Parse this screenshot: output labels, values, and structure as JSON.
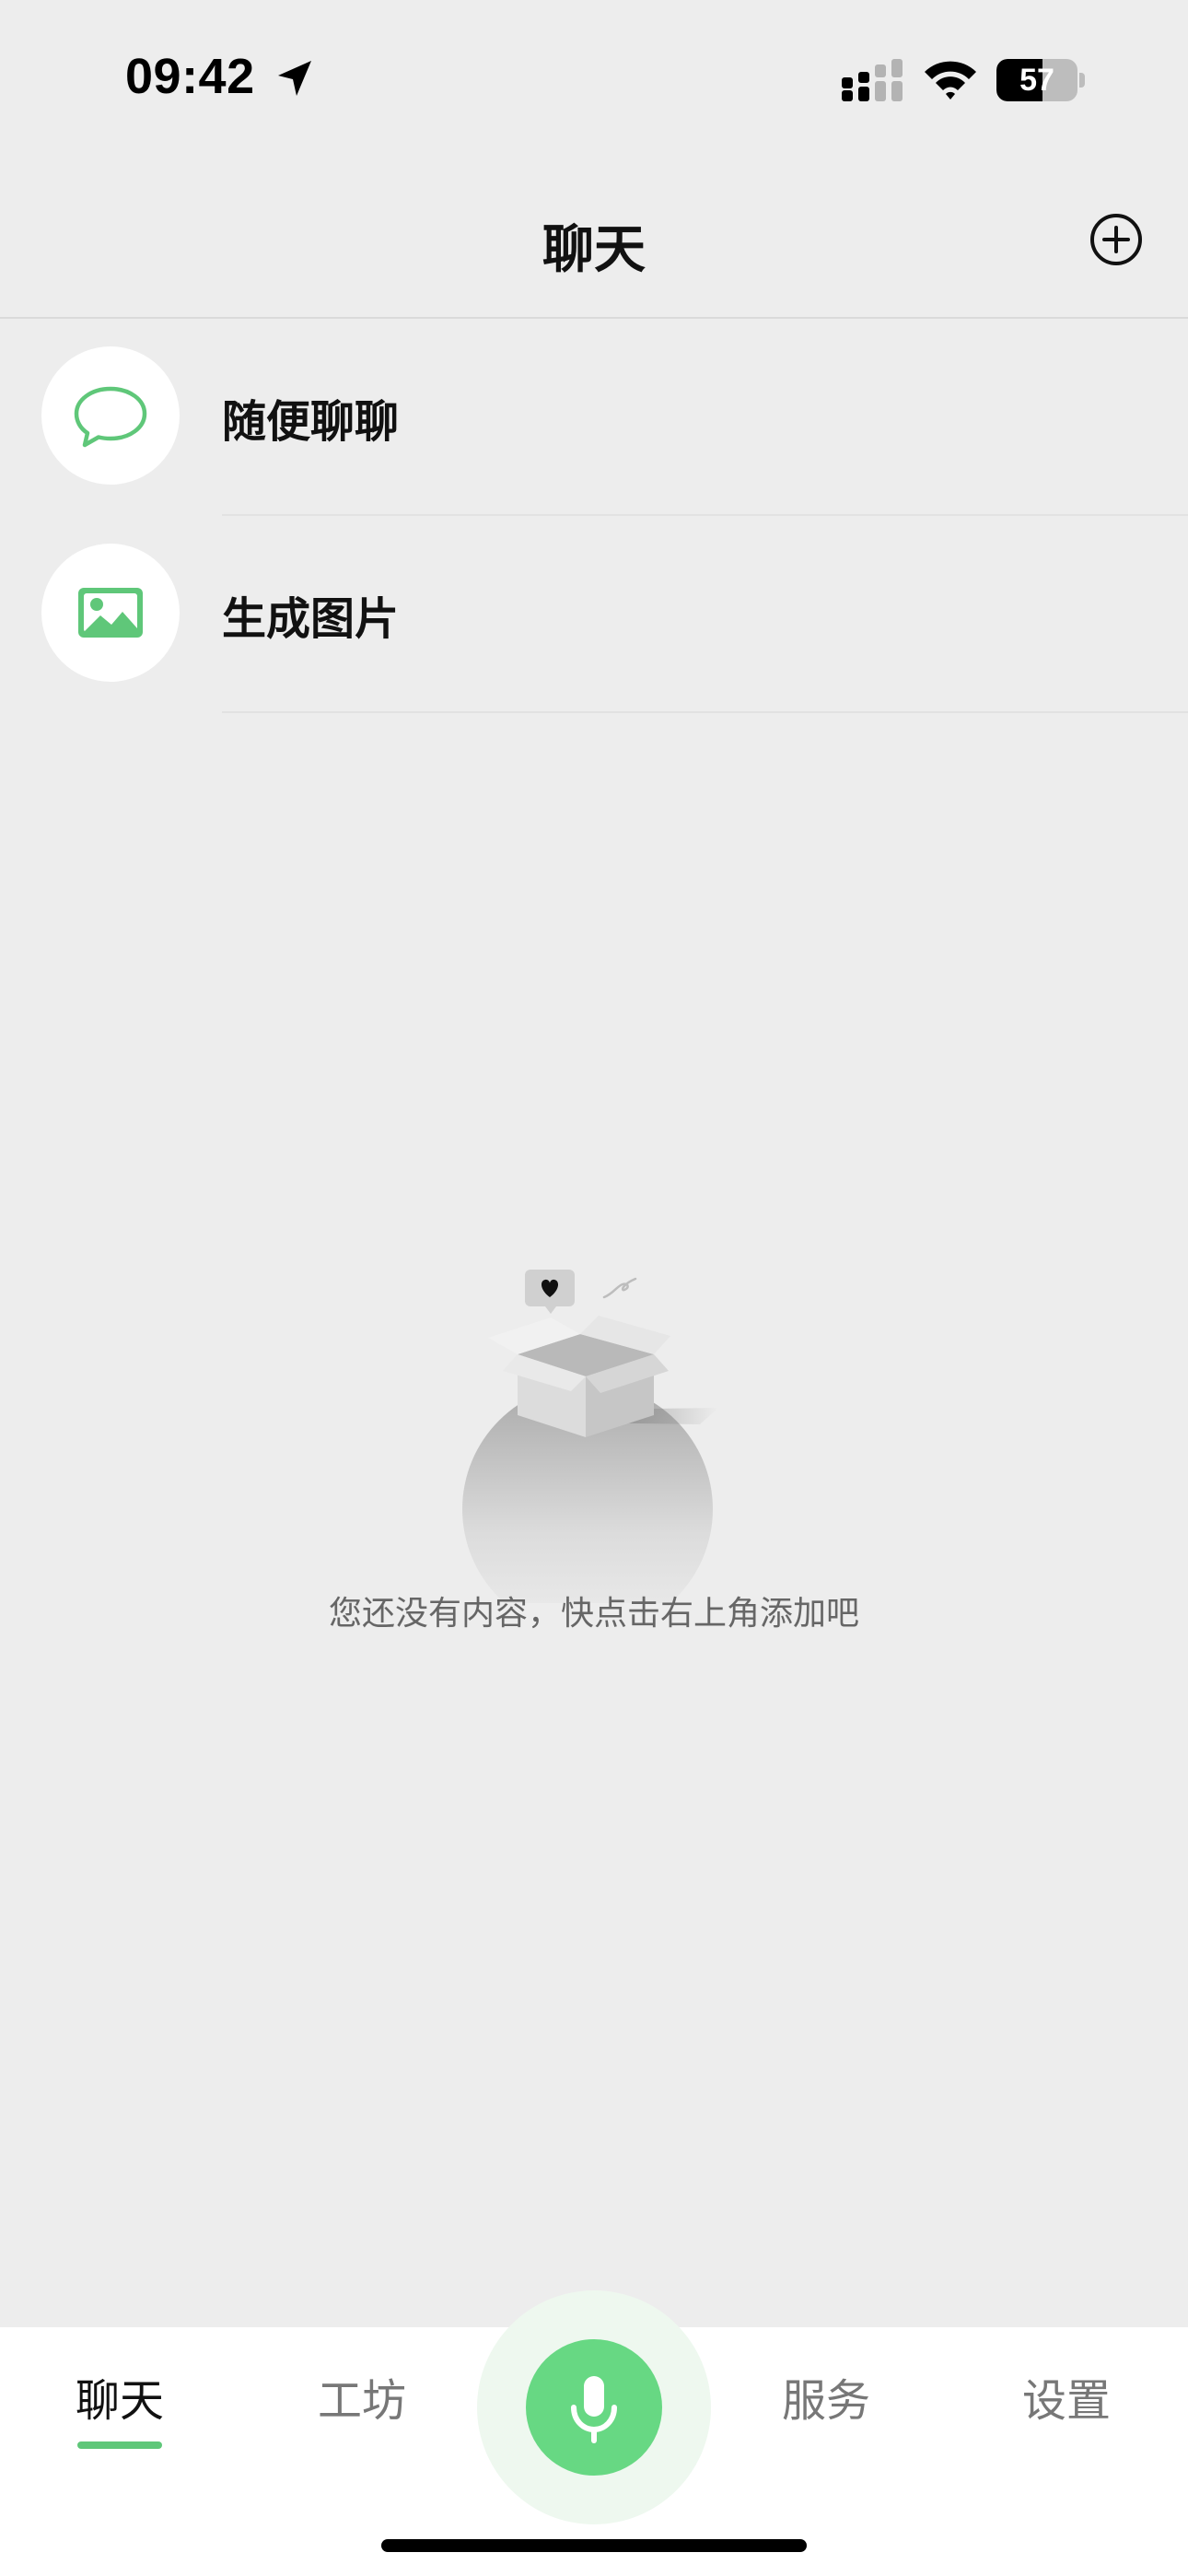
{
  "status_bar": {
    "time": "09:42",
    "battery": "57",
    "battery_level": 0.57,
    "icons": [
      "location-arrow-icon",
      "cellular-signal-icon",
      "wifi-icon",
      "battery-icon"
    ]
  },
  "nav": {
    "title": "聊天",
    "add_icon": "plus-circle-icon"
  },
  "chat_list": {
    "items": [
      {
        "label": "随便聊聊",
        "icon": "speech-bubble-icon"
      },
      {
        "label": "生成图片",
        "icon": "image-icon"
      }
    ]
  },
  "empty_state": {
    "message": "您还没有内容，快点击右上角添加吧",
    "illustration": "open-box-illustration"
  },
  "tab_bar": {
    "tabs": [
      {
        "label": "聊天",
        "active": true
      },
      {
        "label": "工坊",
        "active": false
      },
      {
        "label": "服务",
        "active": false
      },
      {
        "label": "设置",
        "active": false
      }
    ],
    "center_button_icon": "microphone-icon"
  },
  "colors": {
    "background": "#ededed",
    "accent_green": "#5fc779",
    "mic_green": "#67d883",
    "mic_halo": "#eef8ef"
  }
}
